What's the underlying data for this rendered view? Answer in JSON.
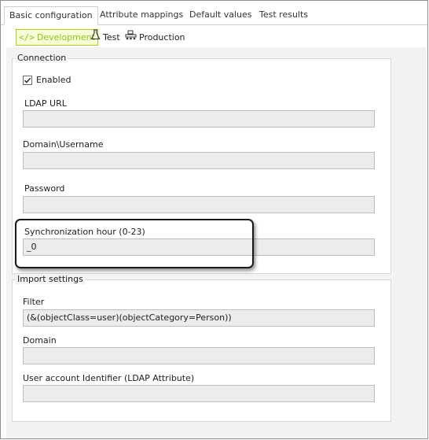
{
  "tabs": {
    "basic": "Basic configuration",
    "attribute": "Attribute mappings",
    "defaults": "Default values",
    "test_results": "Test results"
  },
  "environments": {
    "development": "Development",
    "test": "Test",
    "production": "Production"
  },
  "connection": {
    "title": "Connection",
    "enabled_label": "Enabled",
    "enabled_checked": true,
    "ldap_url_label": "LDAP URL",
    "ldap_url_value": "",
    "domain_username_label": "Domain\\Username",
    "domain_username_value": "",
    "password_label": "Password",
    "password_value": "",
    "sync_hour_label": "Synchronization hour (0-23)",
    "sync_hour_value": "_0"
  },
  "import": {
    "title": "Import settings",
    "filter_label": "Filter",
    "filter_value": "(&(objectClass=user)(objectCategory=Person))",
    "domain_label": "Domain",
    "domain_value": "",
    "account_id_label": "User account Identifier (LDAP Attribute)",
    "account_id_value": ""
  },
  "colors": {
    "accent": "#8cc21a",
    "accent_bg": "#f8ffd8",
    "field_bg": "#ececec"
  }
}
